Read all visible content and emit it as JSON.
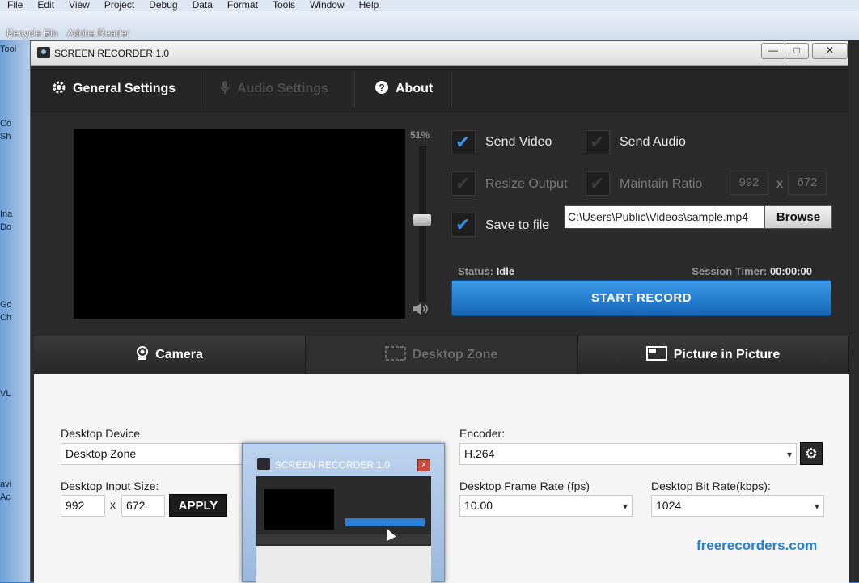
{
  "ide": {
    "menu": [
      "File",
      "Edit",
      "View",
      "Project",
      "Debug",
      "Data",
      "Format",
      "Tools",
      "Window",
      "Help"
    ],
    "desktop_labels": [
      "Recycle Bin",
      "Adobe Reader"
    ],
    "left_strip": [
      "Tool",
      "Co",
      "Sh",
      "Ina",
      "Do",
      "Go",
      "Ch",
      "VL",
      "avi",
      "Ac"
    ]
  },
  "window": {
    "title": "SCREEN RECORDER 1.0",
    "minimize": "—",
    "maximize": "□",
    "close": "✕"
  },
  "top_tabs": {
    "general": "General Settings",
    "audio": "Audio Settings",
    "about": "About"
  },
  "volume": {
    "label": "51%",
    "level": 0.51
  },
  "options": {
    "send_video": {
      "label": "Send Video",
      "checked": true
    },
    "send_audio": {
      "label": "Send Audio",
      "checked": false
    },
    "resize_output": {
      "label": "Resize Output",
      "checked": false
    },
    "maintain_ratio": {
      "label": "Maintain Ratio",
      "checked": false
    },
    "resize_width": "992",
    "resize_height": "672",
    "x_sep": "x",
    "save_to_file": {
      "label": "Save to file",
      "checked": true
    },
    "path": "C:\\Users\\Public\\Videos\\sample.mp4",
    "browse": "Browse"
  },
  "status": {
    "status_label": "Status:",
    "status_value": "Idle",
    "timer_label": "Session Timer:",
    "timer_value": "00:00:00"
  },
  "start_button": "START RECORD",
  "bottom_tabs": {
    "camera": "Camera",
    "desktop_zone": "Desktop Zone",
    "pip": "Picture in Picture"
  },
  "panel": {
    "device_label": "Desktop Device",
    "device_value": "Desktop Zone",
    "input_size_label": "Desktop Input Size:",
    "input_width": "992",
    "input_height": "672",
    "x_sep": "x",
    "apply": "APPLY",
    "encoder_label": "Encoder:",
    "encoder_value": "H.264",
    "framerate_label": "Desktop Frame Rate (fps)",
    "framerate_value": "10.00",
    "bitrate_label": "Desktop Bit Rate(kbps):",
    "bitrate_value": "1024",
    "link": "freerecorders.com"
  },
  "mini_window": {
    "title": "SCREEN RECORDER 1.0",
    "close": "x"
  }
}
